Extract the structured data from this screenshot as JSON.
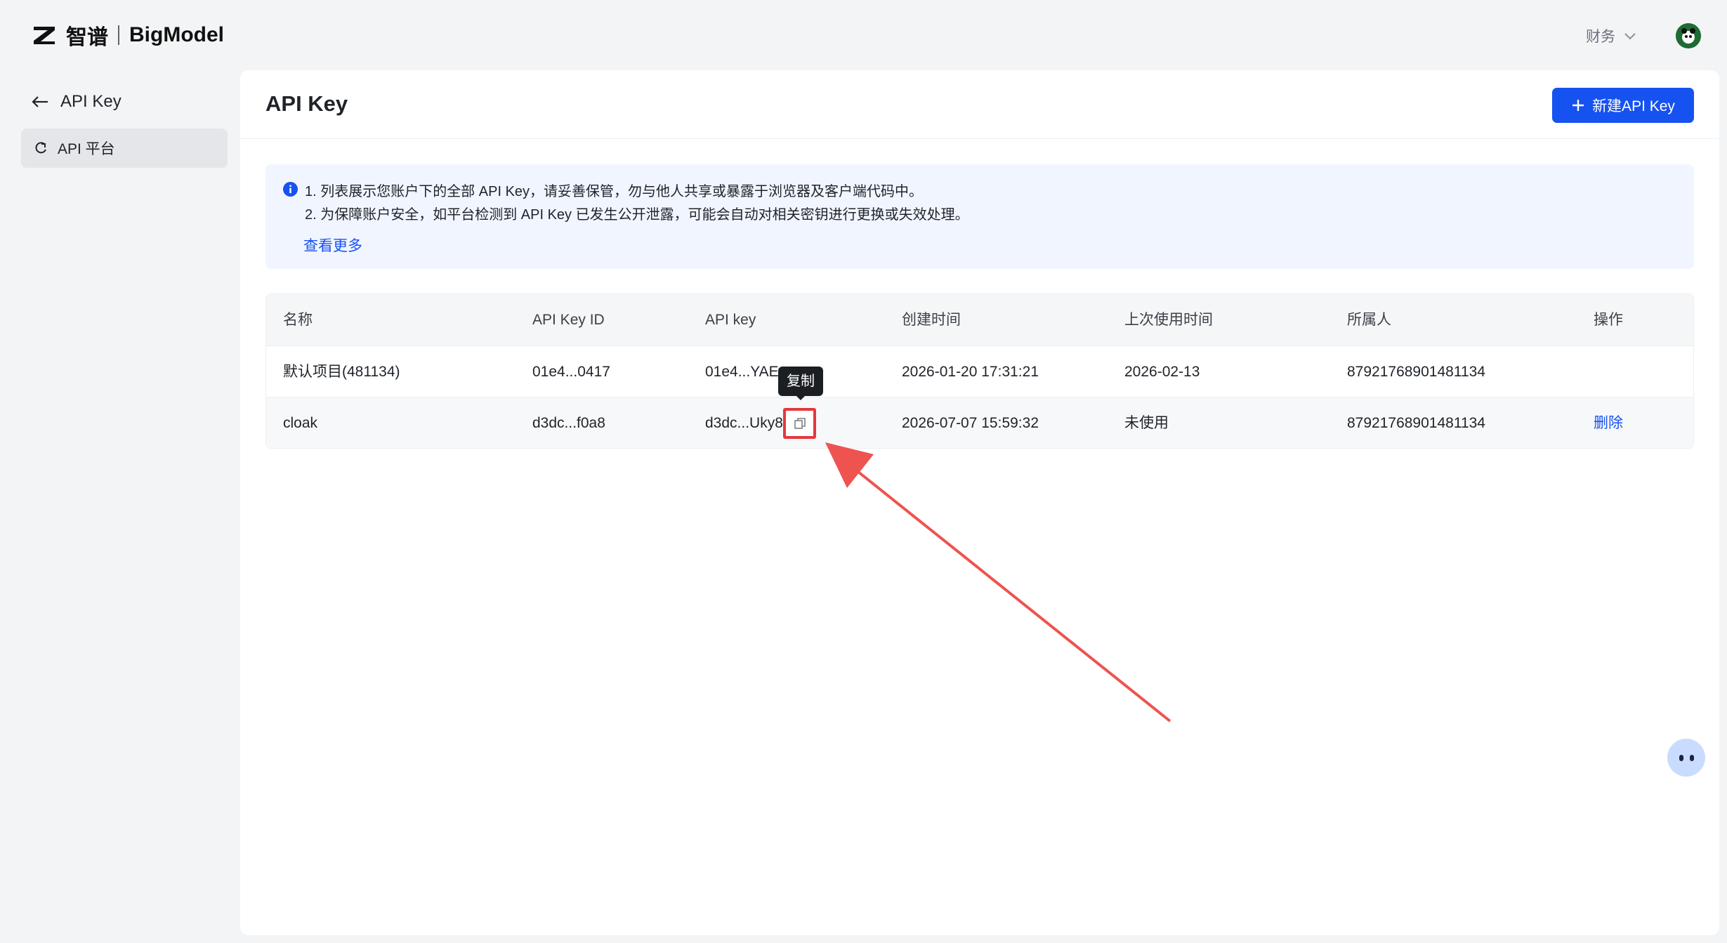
{
  "brand": {
    "cn": "智谱",
    "en": "BigModel"
  },
  "header": {
    "account_menu": "财务"
  },
  "sidebar": {
    "back_label": "API Key",
    "items": [
      {
        "label": "API 平台"
      }
    ]
  },
  "main": {
    "title": "API Key",
    "new_button_label": "新建API Key",
    "notice": {
      "line1": "1. 列表展示您账户下的全部 API Key，请妥善保管，勿与他人共享或暴露于浏览器及客户端代码中。",
      "line2": "2. 为保障账户安全，如平台检测到 API Key 已发生公开泄露，可能会自动对相关密钥进行更换或失效处理。",
      "more_link": "查看更多"
    },
    "table": {
      "columns": [
        "名称",
        "API Key ID",
        "API key",
        "创建时间",
        "上次使用时间",
        "所属人",
        "操作"
      ],
      "rows": [
        {
          "name": "默认项目(481134)",
          "id": "01e4...0417",
          "key": "01e4...YAE",
          "created": "2026-01-20 17:31:21",
          "last_used": "2026-02-13",
          "owner": "87921768901481134",
          "action": ""
        },
        {
          "name": "cloak",
          "id": "d3dc...f0a8",
          "key": "d3dc...Uky8",
          "created": "2026-07-07 15:59:32",
          "last_used": "未使用",
          "owner": "87921768901481134",
          "action": "删除"
        }
      ]
    },
    "tooltip": "复制"
  },
  "colors": {
    "primary": "#1652f0",
    "highlight": "#e5383b",
    "notice_bg": "#f1f5ff"
  },
  "icons": [
    "z-logo-icon",
    "chevron-down-icon",
    "avatar",
    "arrow-left-icon",
    "platform-icon",
    "plus-icon",
    "info-icon",
    "copy-icon",
    "assistant-bot-icon"
  ]
}
